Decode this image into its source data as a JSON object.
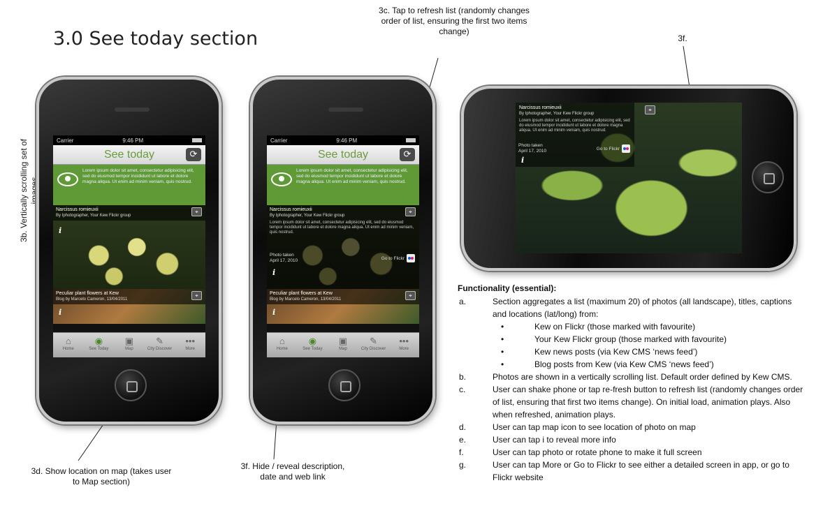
{
  "title": "3.0 See today section",
  "annotations": {
    "a3b": "3b. Vertically scrolling set of images",
    "a3c": "3c. Tap to refresh list (randomly changes order of list, ensuring the first two items change)",
    "a3f_top": "3f.",
    "a3d": "3d. Show location on map (takes user to Map section)",
    "a3f_bottom": "3f. Hide / reveal description, date and web link"
  },
  "phone": {
    "carrier": "Carrier",
    "time": "9:46 PM",
    "header_title": "See today",
    "refresh_icon": "refresh-icon",
    "intro": "Lorem ipsum dolor sit amet, consectetur adipisicing elit, sed do eiusmod tempor incididunt ut labore et dolore magna aliqua. Ut enim ad minim veniam, quis nostrud.",
    "card1": {
      "title": "Narcissus romieuxii",
      "byline": "By Iphotographer, Your Kew Flickr group",
      "description": "Lorem ipsum dolor sit amet, consectetur adipisicing elit, sed do eiusmod tempor incididunt ut labore et dolore magna aliqua. Ut enim ad minim veniam, quis nostrud.",
      "taken_label": "Photo taken",
      "taken_date": "April 17, 2010",
      "flickr_label": "Go to Flickr"
    },
    "card2": {
      "title": "Peculiar plant flowers at Kew",
      "byline": "Blog by Marcelo Cameron, 13/04/2011"
    },
    "tabs": [
      "Home",
      "See Today",
      "Map",
      "City Discover",
      "More"
    ]
  },
  "functionality": {
    "heading": "Functionality (essential):",
    "items": [
      {
        "letter": "a.",
        "text": "Section aggregates a list (maximum 20) of photos (all landscape), titles, captions and locations (lat/long) from:"
      },
      {
        "letter": "b.",
        "text": "Photos are shown in a vertically scrolling list. Default order defined by Kew CMS."
      },
      {
        "letter": "c.",
        "text": "User can shake phone or tap re-fresh button to refresh list (randomly changes order of list, ensuring that first two items change). On initial load, animation plays. Also when refreshed, animation plays."
      },
      {
        "letter": "d.",
        "text": "User can tap map icon to see location of photo on map"
      },
      {
        "letter": "e.",
        "text": "User can tap i to reveal more info"
      },
      {
        "letter": "f.",
        "text": "User can tap photo or rotate phone to make it full screen"
      },
      {
        "letter": "g.",
        "text": "User can tap More or Go to Flickr to see either a detailed screen in app, or go to Flickr website"
      }
    ],
    "sources": [
      "Kew on Flickr (those marked with favourite)",
      "Your Kew Flickr group (those marked with favourite)",
      "Kew news posts (via Kew CMS ‘news feed’)",
      "Blog posts from Kew (via Kew CMS ‘news feed’)"
    ]
  }
}
